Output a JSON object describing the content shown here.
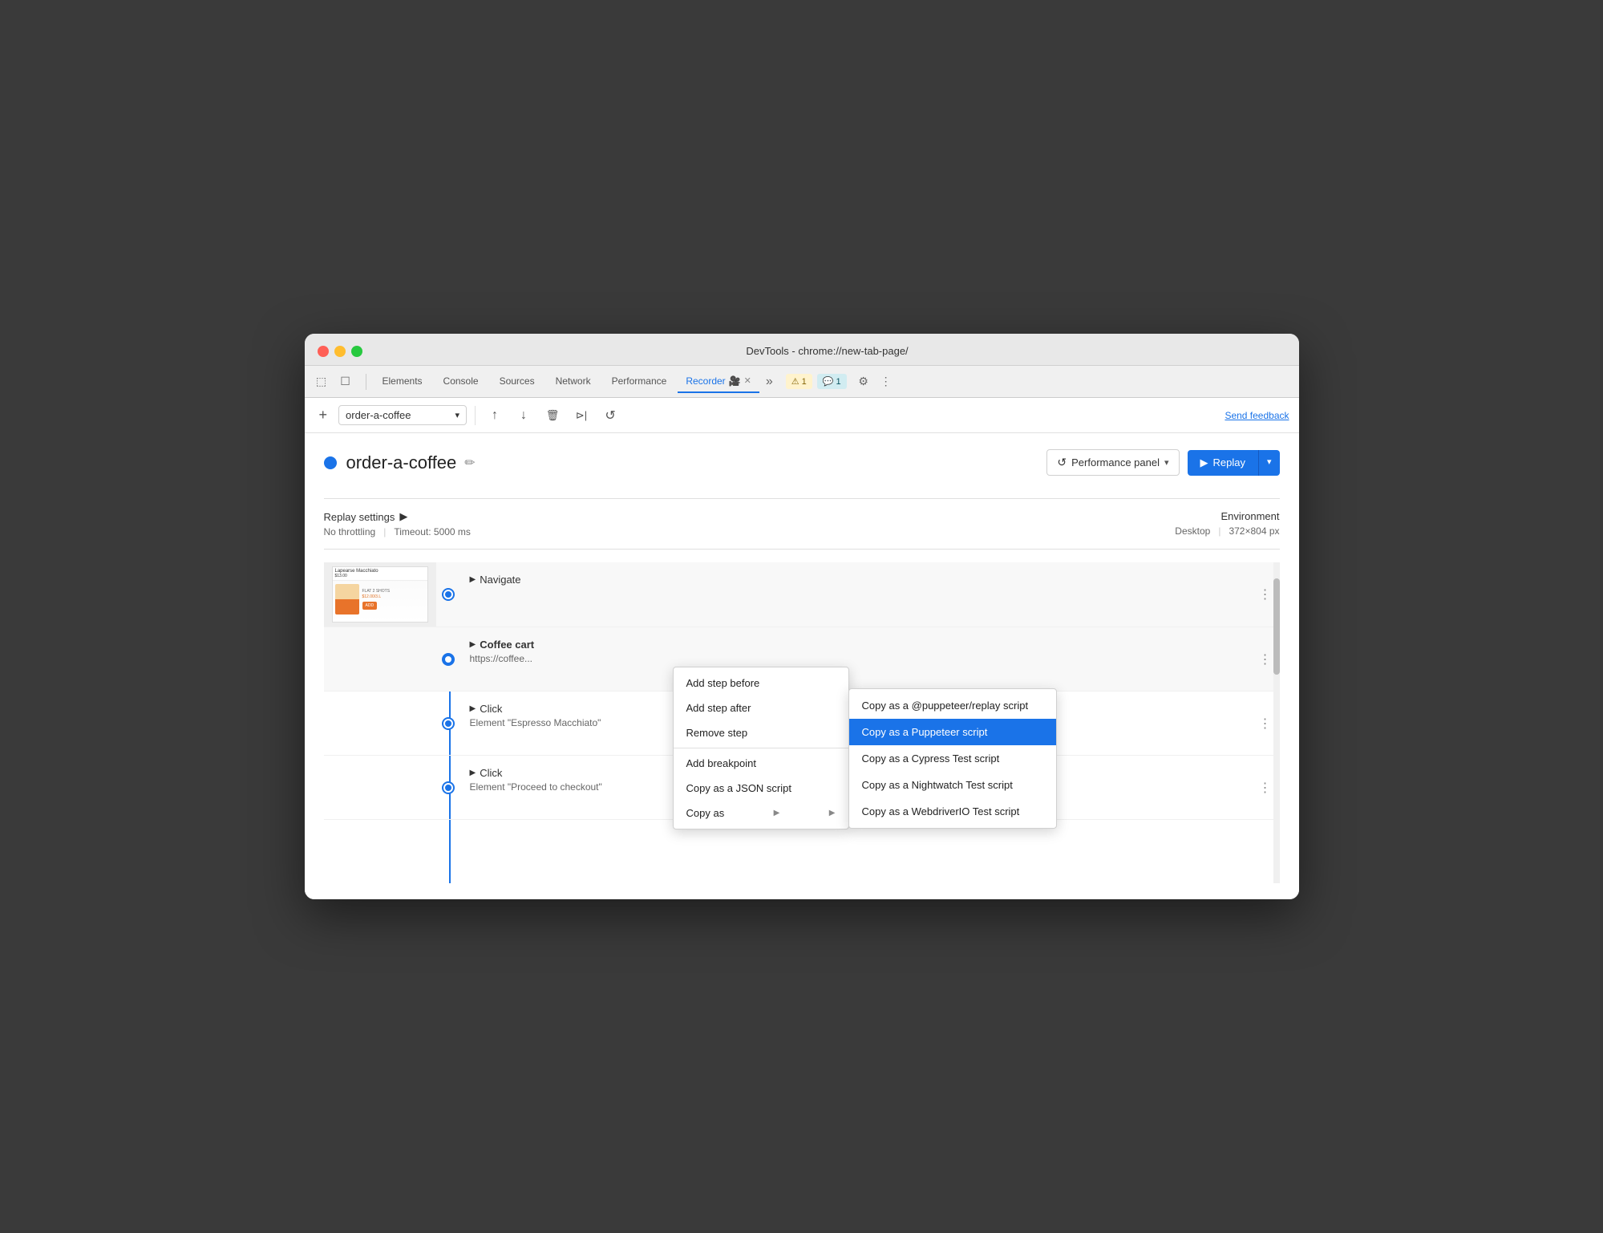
{
  "window": {
    "title": "DevTools - chrome://new-tab-page/"
  },
  "traffic_lights": {
    "red": "#ff5f56",
    "yellow": "#ffbd2e",
    "green": "#27c93f"
  },
  "devtools_tabs": {
    "items": [
      {
        "label": "Elements",
        "active": false
      },
      {
        "label": "Console",
        "active": false
      },
      {
        "label": "Sources",
        "active": false
      },
      {
        "label": "Network",
        "active": false
      },
      {
        "label": "Performance",
        "active": false
      },
      {
        "label": "Recorder",
        "active": true
      }
    ],
    "badges": {
      "warning": "⚠ 1",
      "info": "💬 1"
    },
    "more": "»"
  },
  "toolbar": {
    "add_label": "+",
    "recording_name": "order-a-coffee",
    "send_feedback": "Send feedback"
  },
  "header": {
    "dot_color": "#1a73e8",
    "title": "order-a-coffee",
    "edit_icon": "✏",
    "perf_panel_label": "Performance panel",
    "replay_label": "Replay"
  },
  "settings": {
    "title": "Replay settings",
    "arrow": "▶",
    "throttling": "No throttling",
    "timeout": "Timeout: 5000 ms",
    "separator": "|",
    "env_title": "Environment",
    "env_device": "Desktop",
    "env_size": "372×804 px"
  },
  "steps": [
    {
      "id": "step-navigate",
      "has_thumbnail": true,
      "name": "Navigate",
      "detail": "",
      "dot_type": "filled"
    },
    {
      "id": "step-coffee-cart",
      "has_thumbnail": false,
      "name": "Coffee cart",
      "detail": "https://coffee...",
      "dot_type": "open"
    },
    {
      "id": "step-click-1",
      "has_thumbnail": false,
      "name": "Click",
      "detail": "Element \"Espresso Macchiato\"",
      "dot_type": "filled"
    },
    {
      "id": "step-click-2",
      "has_thumbnail": false,
      "name": "Click",
      "detail": "Element \"Proceed to checkout\"",
      "dot_type": "filled"
    }
  ],
  "context_menu": {
    "items": [
      {
        "label": "Add step before",
        "has_submenu": false,
        "separator_after": false
      },
      {
        "label": "Add step after",
        "has_submenu": false,
        "separator_after": false
      },
      {
        "label": "Remove step",
        "has_submenu": false,
        "separator_after": true
      },
      {
        "label": "Add breakpoint",
        "has_submenu": false,
        "separator_after": false
      },
      {
        "label": "Copy as a JSON script",
        "has_submenu": false,
        "separator_after": false
      },
      {
        "label": "Copy as",
        "has_submenu": true,
        "separator_after": false
      }
    ]
  },
  "submenu": {
    "items": [
      {
        "label": "Copy as a @puppeteer/replay script",
        "selected": false
      },
      {
        "label": "Copy as a Puppeteer script",
        "selected": true
      },
      {
        "label": "Copy as a Cypress Test script",
        "selected": false
      },
      {
        "label": "Copy as a Nightwatch Test script",
        "selected": false
      },
      {
        "label": "Copy as a WebdriverIO Test script",
        "selected": false
      }
    ]
  },
  "icons": {
    "export": "↑",
    "import": "↓",
    "delete": "🗑",
    "play_step": "⊳|",
    "circle_replay": "↺",
    "more_vert": "⋮",
    "chevron_right": "▶",
    "dropdown": "▾",
    "play": "▶"
  }
}
